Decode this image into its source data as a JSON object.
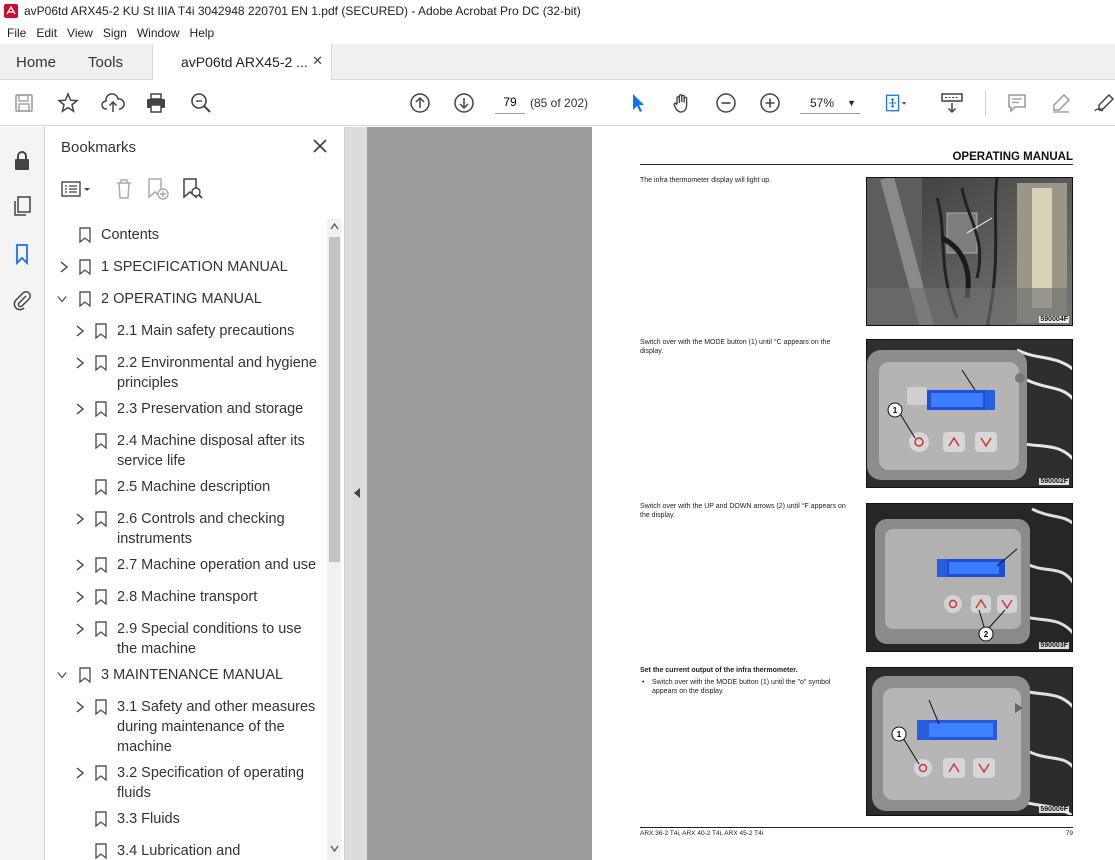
{
  "window": {
    "title": "avP06td ARX45-2 KU St IIIA T4i 3042948 220701 EN 1.pdf (SECURED) - Adobe Acrobat Pro DC (32-bit)"
  },
  "menu": [
    "File",
    "Edit",
    "View",
    "Sign",
    "Window",
    "Help"
  ],
  "tabs": {
    "home": "Home",
    "tools": "Tools",
    "document": "avP06td ARX45-2 ..."
  },
  "toolbar": {
    "page_number": "79",
    "page_count": "(85 of 202)",
    "zoom": "57%"
  },
  "bookmarks": {
    "title": "Bookmarks",
    "items": [
      {
        "label": "Contents"
      },
      {
        "label": "1 SPECIFICATION MANUAL"
      },
      {
        "label": "2 OPERATING MANUAL"
      },
      {
        "label": "2.1 Main safety precautions"
      },
      {
        "label": "2.2 Environmental and hygiene",
        "label2": "principles"
      },
      {
        "label": "2.3 Preservation and storage"
      },
      {
        "label": "2.4 Machine disposal after its",
        "label2": "service life"
      },
      {
        "label": "2.5 Machine description"
      },
      {
        "label": "2.6 Controls and checking",
        "label2": "instruments"
      },
      {
        "label": "2.7 Machine operation and use"
      },
      {
        "label": "2.8 Machine transport"
      },
      {
        "label": "2.9 Special conditions to use",
        "label2": "the machine"
      },
      {
        "label": "3 MAINTENANCE MANUAL"
      },
      {
        "label": "3.1 Safety and other measures",
        "label2": "during maintenance of the",
        "label3": "machine"
      },
      {
        "label": "3.2 Specification of operating",
        "label2": "fluids"
      },
      {
        "label": "3.3 Fluids"
      },
      {
        "label": "3.4 Lubrication and"
      }
    ]
  },
  "document": {
    "header": "OPERATING MANUAL",
    "sections": [
      {
        "text": "The infra thermometer display will light up.",
        "photo_code": "590004F"
      },
      {
        "text": "Switch over with the MODE button (1) until °C appears on the display.",
        "photo_code": "590002F"
      },
      {
        "text": "Switch over with the UP and DOWN arrows (2) until °F appears on the display.",
        "photo_code": "590003F"
      },
      {
        "heading": "Set the current output of the infra thermometer.",
        "bullet": "Switch over with the MODE button (1) until the \"o\" symbol appears on the display.",
        "photo_code": "590006F"
      }
    ],
    "callouts": {
      "one": "1",
      "two": "2"
    },
    "footer_left": "ARX 36-2 T4i, ARX 40-2 T4i, ARX 45-2 T4i",
    "footer_page": "79"
  }
}
